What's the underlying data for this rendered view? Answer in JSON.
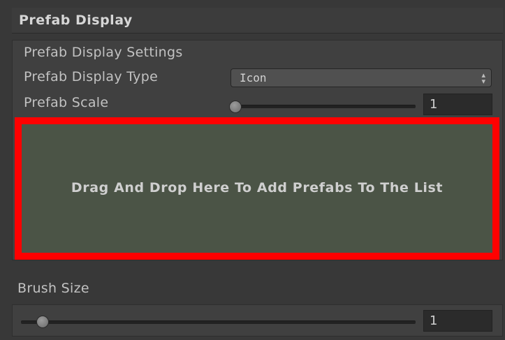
{
  "header": {
    "title": "Prefab Display"
  },
  "settings": {
    "section_label": "Prefab Display Settings",
    "display_type": {
      "label": "Prefab Display Type",
      "value": "Icon"
    },
    "scale": {
      "label": "Prefab Scale",
      "value": "1"
    }
  },
  "dropzone": {
    "text": "Drag And Drop Here To Add Prefabs To The List",
    "highlight_color": "#ff0000"
  },
  "brush": {
    "label": "Brush Size",
    "value": "1"
  }
}
